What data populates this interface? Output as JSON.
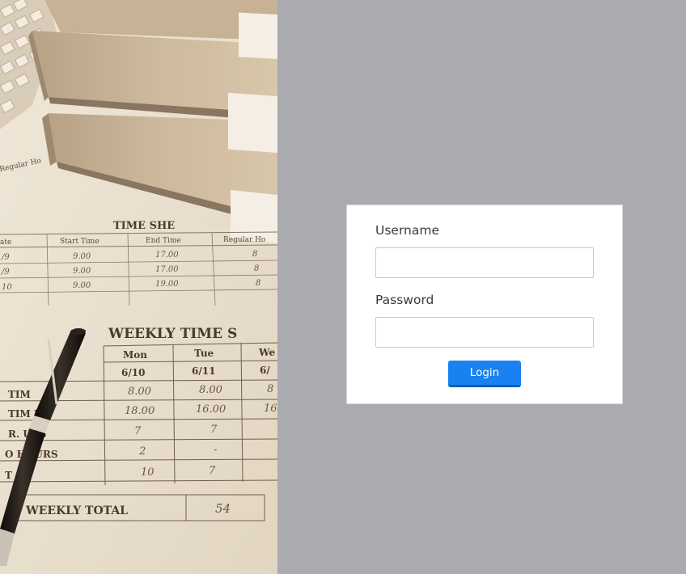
{
  "login": {
    "username_label": "Username",
    "username_value": "",
    "password_label": "Password",
    "password_value": "",
    "login_label": "Login"
  },
  "timesheet": {
    "heading_top": "TIME SHE",
    "heading_main": "WEEKLY TIME S",
    "regular_hours": "Regular Ho",
    "top_cols": [
      "ate",
      "Start Time",
      "End Time",
      "Regular Ho"
    ],
    "top_rows": [
      [
        "/9",
        "9.00",
        "17.00",
        "8"
      ],
      [
        "/9",
        "9.00",
        "17.00",
        "8"
      ],
      [
        "10",
        "9.00",
        "19.00",
        "8"
      ]
    ],
    "days": [
      "Mon",
      "Tue",
      "We"
    ],
    "dates": [
      "6/10",
      "6/11",
      "6/"
    ],
    "row_labels": [
      "TIM",
      "TIM   UT",
      "R.   URS",
      "O    HOURS",
      "T   AL"
    ],
    "rows": [
      [
        "8.00",
        "8.00",
        "8"
      ],
      [
        "18.00",
        "16.00",
        "16"
      ],
      [
        "7",
        "7",
        ""
      ],
      [
        "2",
        "-",
        ""
      ],
      [
        "10",
        "7",
        ""
      ]
    ],
    "weekly_total_label": "WEEKLY TOTAL",
    "weekly_total_value": "54"
  },
  "colors": {
    "background": "#a9abae",
    "button": "#1a82f0",
    "card": "#ffffff"
  }
}
